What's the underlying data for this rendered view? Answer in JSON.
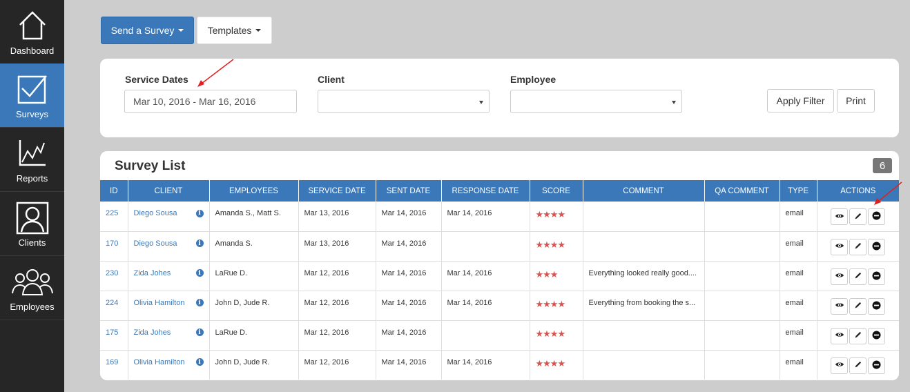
{
  "sidebar": {
    "items": [
      {
        "label": "Dashboard",
        "icon": "home-icon",
        "active": false
      },
      {
        "label": "Surveys",
        "icon": "checkbox-icon",
        "active": true
      },
      {
        "label": "Reports",
        "icon": "line-chart-icon",
        "active": false
      },
      {
        "label": "Clients",
        "icon": "user-portrait-icon",
        "active": false
      },
      {
        "label": "Employees",
        "icon": "users-group-icon",
        "active": false
      }
    ]
  },
  "toolbar": {
    "send_survey_label": "Send a Survey",
    "templates_label": "Templates"
  },
  "filter": {
    "service_dates_label": "Service Dates",
    "service_dates_value": "Mar 10, 2016 - Mar 16, 2016",
    "client_label": "Client",
    "client_value": "",
    "employee_label": "Employee",
    "employee_value": "",
    "apply_label": "Apply Filter",
    "print_label": "Print"
  },
  "survey_list": {
    "title": "Survey List",
    "count": "6",
    "columns": [
      "ID",
      "CLIENT",
      "EMPLOYEES",
      "SERVICE DATE",
      "SENT DATE",
      "RESPONSE DATE",
      "SCORE",
      "COMMENT",
      "QA COMMENT",
      "TYPE",
      "ACTIONS"
    ],
    "rows": [
      {
        "id": "225",
        "client": "Diego Sousa",
        "employees": "Amanda S., Matt S.",
        "service_date": "Mar 13, 2016",
        "sent_date": "Mar 14, 2016",
        "response_date": "Mar 14, 2016",
        "score": "★★★★",
        "comment": "",
        "qa_comment": "",
        "type": "email"
      },
      {
        "id": "170",
        "client": "Diego Sousa",
        "employees": "Amanda S.",
        "service_date": "Mar 13, 2016",
        "sent_date": "Mar 14, 2016",
        "response_date": "",
        "score": "★★★★",
        "comment": "",
        "qa_comment": "",
        "type": "email"
      },
      {
        "id": "230",
        "client": "Zida Johes",
        "employees": "LaRue D.",
        "service_date": "Mar 12, 2016",
        "sent_date": "Mar 14, 2016",
        "response_date": "Mar 14, 2016",
        "score": "★★★",
        "comment": "Everything looked really good....",
        "qa_comment": "",
        "type": "email"
      },
      {
        "id": "224",
        "client": "Olivia Hamilton",
        "employees": "John D, Jude R.",
        "service_date": "Mar 12, 2016",
        "sent_date": "Mar 14, 2016",
        "response_date": "Mar 14, 2016",
        "score": "★★★★",
        "comment": "Everything from booking the s...",
        "qa_comment": "",
        "type": "email"
      },
      {
        "id": "175",
        "client": "Zida Johes",
        "employees": "LaRue D.",
        "service_date": "Mar 12, 2016",
        "sent_date": "Mar 14, 2016",
        "response_date": "",
        "score": "★★★★",
        "comment": "",
        "qa_comment": "",
        "type": "email"
      },
      {
        "id": "169",
        "client": "Olivia Hamilton",
        "employees": "John D, Jude R.",
        "service_date": "Mar 12, 2016",
        "sent_date": "Mar 14, 2016",
        "response_date": "Mar 14, 2016",
        "score": "★★★★",
        "comment": "",
        "qa_comment": "",
        "type": "email"
      }
    ]
  },
  "colors": {
    "brand_blue": "#3a78b9",
    "sidebar_bg": "#262626",
    "star_red": "#d9534f",
    "annotation_red": "#e02020"
  }
}
